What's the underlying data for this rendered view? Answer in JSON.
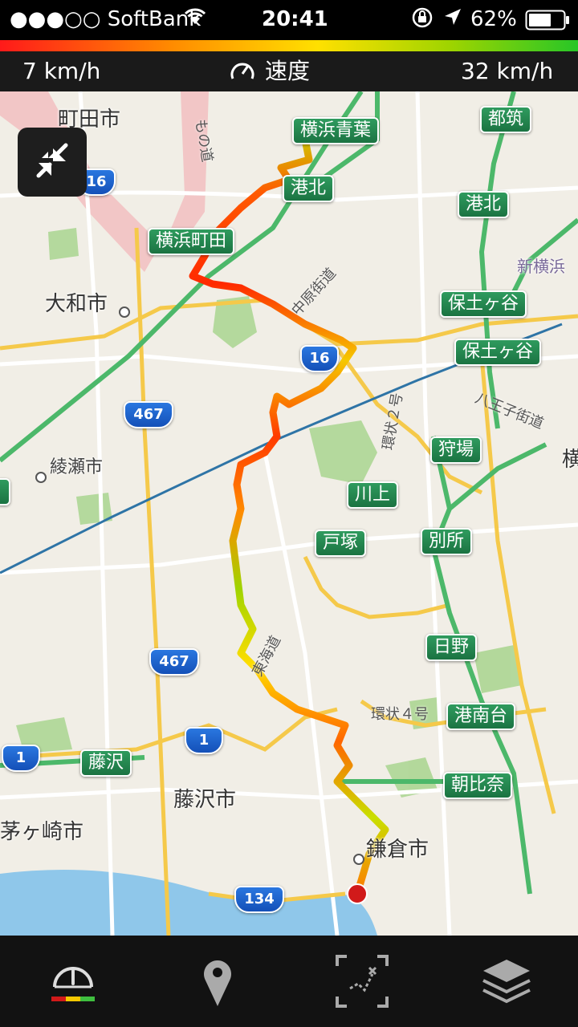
{
  "status_bar": {
    "carrier": "●●●○○ SoftBank",
    "time": "20:41",
    "battery_percent": "62%"
  },
  "speed_bar": {
    "min_speed": "7 km/h",
    "label": "速度",
    "max_speed": "32 km/h"
  },
  "map": {
    "road_signs": [
      "横浜青葉",
      "港北",
      "都筑",
      "港北",
      "横浜町田",
      "保土ヶ谷",
      "保土ヶ谷",
      "狩場",
      "川上",
      "戸塚",
      "別所",
      "日野",
      "港南台",
      "朝比奈",
      "藤沢"
    ],
    "route_shields": [
      "16",
      "16",
      "467",
      "467",
      "1",
      "1",
      "134"
    ],
    "city_labels": [
      "町田市",
      "大和市",
      "綾瀬市",
      "藤沢市",
      "茅ヶ崎市",
      "鎌倉市",
      "新横浜",
      "横"
    ],
    "road_labels": [
      "中原街道",
      "八王子街道",
      "環状２号",
      "環状４号",
      "東海道",
      "もの道"
    ],
    "route_colors": {
      "start": "#7dcc1a",
      "end": "#d11a1a",
      "slow": "#ff2a00",
      "fast": "#a8d400"
    }
  },
  "tab_bar": {
    "icons": [
      "speedometer-icon",
      "location-pin-icon",
      "route-select-icon",
      "layers-icon"
    ],
    "selected": "speedometer-icon"
  }
}
